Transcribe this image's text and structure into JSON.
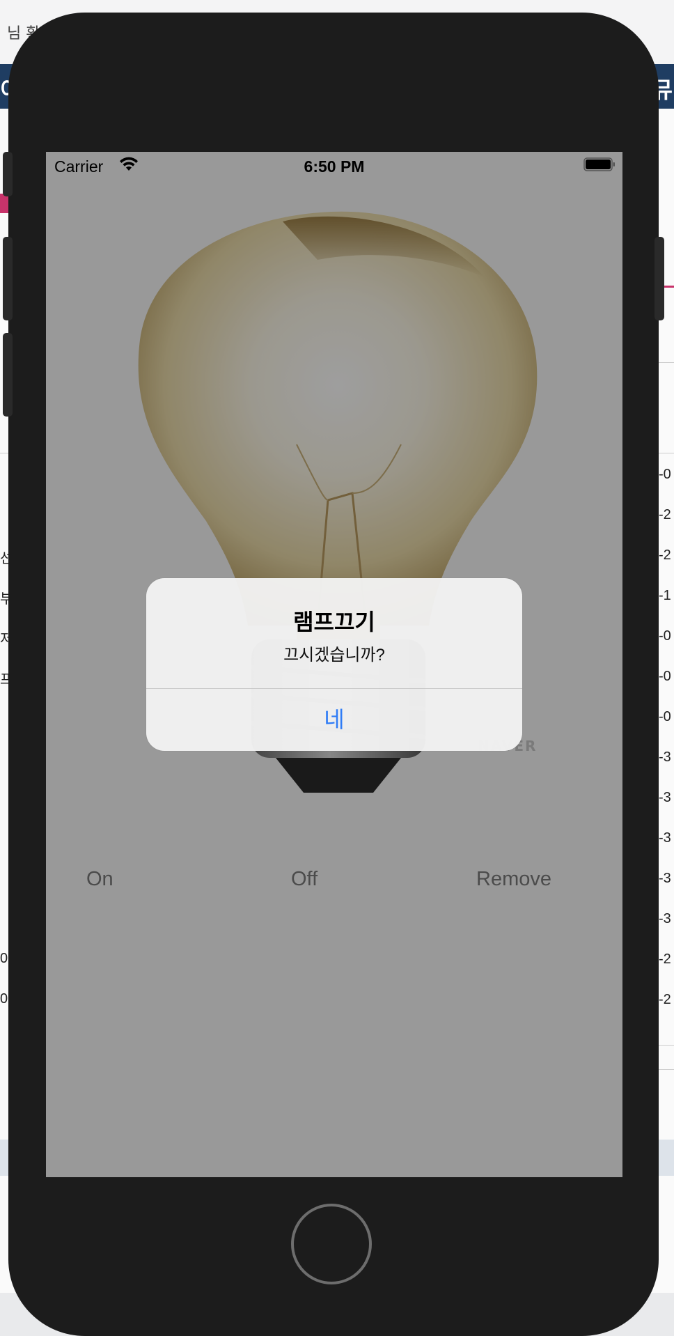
{
  "background_page": {
    "top_text": "님 환",
    "navbar_left": "이",
    "navbar_right": "뮤",
    "right_cells": [
      "-0",
      "-2",
      "-2",
      "-1",
      "-0",
      "-0",
      "-0",
      "-3",
      "-3",
      "-3",
      "-3",
      "-3",
      "-2",
      "-2"
    ],
    "left_cells": [
      "선",
      "부",
      "저",
      "프로",
      "0",
      "0"
    ]
  },
  "status_bar": {
    "carrier": "Carrier",
    "time": "6:50 PM"
  },
  "app": {
    "image": "lightbulb-image",
    "watermark": "NAVER",
    "buttons": {
      "on": "On",
      "off": "Off",
      "remove": "Remove"
    }
  },
  "alert": {
    "title": "램프끄기",
    "message": "끄시겠습니까?",
    "confirm_button": "네"
  },
  "colors": {
    "alert_button": "#2f7cf6",
    "device_frame": "#1c1c1c",
    "navbar": "#1f3d62"
  }
}
